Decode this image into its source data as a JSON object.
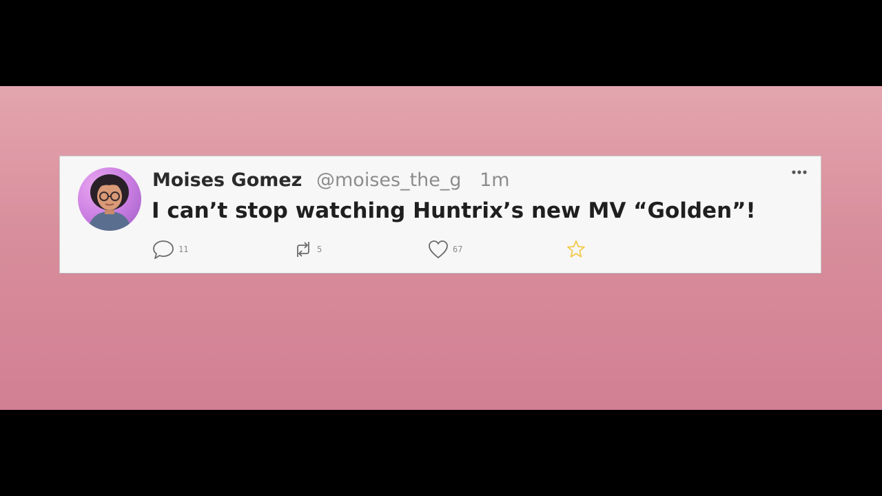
{
  "tweet": {
    "display_name": "Moises Gomez",
    "handle": "@moises_the_g",
    "timestamp": "1m",
    "text": "I can’t stop watching Huntrix’s new MV “Golden”!",
    "avatar_icon": "avatar-person-glasses",
    "more_icon": "more-horizontal-icon"
  },
  "actions": {
    "reply": {
      "icon": "comment-icon",
      "count": "11"
    },
    "retweet": {
      "icon": "retweet-icon",
      "count": "5"
    },
    "like": {
      "icon": "heart-icon",
      "count": "67"
    },
    "favorite": {
      "icon": "star-icon",
      "color": "#f2c94c"
    }
  },
  "colors": {
    "background_top": "#e3a5ae",
    "background_bottom": "#d17f92",
    "card": "#f7f7f7",
    "muted_text": "#8c8c8c"
  }
}
